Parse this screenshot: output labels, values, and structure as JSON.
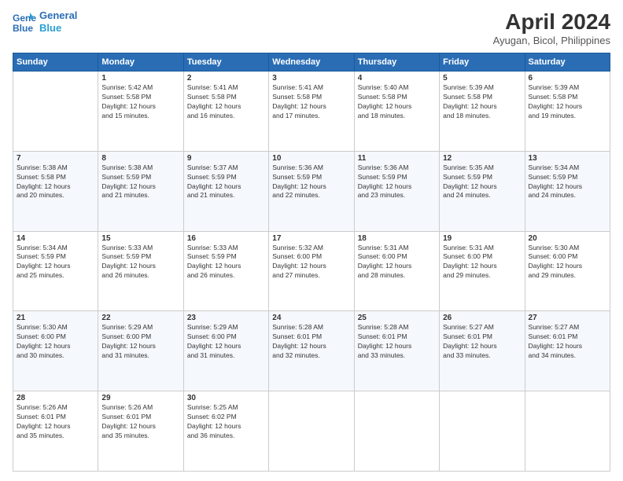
{
  "header": {
    "logo_line1": "General",
    "logo_line2": "Blue",
    "title": "April 2024",
    "location": "Ayugan, Bicol, Philippines"
  },
  "weekdays": [
    "Sunday",
    "Monday",
    "Tuesday",
    "Wednesday",
    "Thursday",
    "Friday",
    "Saturday"
  ],
  "weeks": [
    [
      {
        "day": "",
        "content": ""
      },
      {
        "day": "1",
        "content": "Sunrise: 5:42 AM\nSunset: 5:58 PM\nDaylight: 12 hours\nand 15 minutes."
      },
      {
        "day": "2",
        "content": "Sunrise: 5:41 AM\nSunset: 5:58 PM\nDaylight: 12 hours\nand 16 minutes."
      },
      {
        "day": "3",
        "content": "Sunrise: 5:41 AM\nSunset: 5:58 PM\nDaylight: 12 hours\nand 17 minutes."
      },
      {
        "day": "4",
        "content": "Sunrise: 5:40 AM\nSunset: 5:58 PM\nDaylight: 12 hours\nand 18 minutes."
      },
      {
        "day": "5",
        "content": "Sunrise: 5:39 AM\nSunset: 5:58 PM\nDaylight: 12 hours\nand 18 minutes."
      },
      {
        "day": "6",
        "content": "Sunrise: 5:39 AM\nSunset: 5:58 PM\nDaylight: 12 hours\nand 19 minutes."
      }
    ],
    [
      {
        "day": "7",
        "content": "Sunrise: 5:38 AM\nSunset: 5:58 PM\nDaylight: 12 hours\nand 20 minutes."
      },
      {
        "day": "8",
        "content": "Sunrise: 5:38 AM\nSunset: 5:59 PM\nDaylight: 12 hours\nand 21 minutes."
      },
      {
        "day": "9",
        "content": "Sunrise: 5:37 AM\nSunset: 5:59 PM\nDaylight: 12 hours\nand 21 minutes."
      },
      {
        "day": "10",
        "content": "Sunrise: 5:36 AM\nSunset: 5:59 PM\nDaylight: 12 hours\nand 22 minutes."
      },
      {
        "day": "11",
        "content": "Sunrise: 5:36 AM\nSunset: 5:59 PM\nDaylight: 12 hours\nand 23 minutes."
      },
      {
        "day": "12",
        "content": "Sunrise: 5:35 AM\nSunset: 5:59 PM\nDaylight: 12 hours\nand 24 minutes."
      },
      {
        "day": "13",
        "content": "Sunrise: 5:34 AM\nSunset: 5:59 PM\nDaylight: 12 hours\nand 24 minutes."
      }
    ],
    [
      {
        "day": "14",
        "content": "Sunrise: 5:34 AM\nSunset: 5:59 PM\nDaylight: 12 hours\nand 25 minutes."
      },
      {
        "day": "15",
        "content": "Sunrise: 5:33 AM\nSunset: 5:59 PM\nDaylight: 12 hours\nand 26 minutes."
      },
      {
        "day": "16",
        "content": "Sunrise: 5:33 AM\nSunset: 5:59 PM\nDaylight: 12 hours\nand 26 minutes."
      },
      {
        "day": "17",
        "content": "Sunrise: 5:32 AM\nSunset: 6:00 PM\nDaylight: 12 hours\nand 27 minutes."
      },
      {
        "day": "18",
        "content": "Sunrise: 5:31 AM\nSunset: 6:00 PM\nDaylight: 12 hours\nand 28 minutes."
      },
      {
        "day": "19",
        "content": "Sunrise: 5:31 AM\nSunset: 6:00 PM\nDaylight: 12 hours\nand 29 minutes."
      },
      {
        "day": "20",
        "content": "Sunrise: 5:30 AM\nSunset: 6:00 PM\nDaylight: 12 hours\nand 29 minutes."
      }
    ],
    [
      {
        "day": "21",
        "content": "Sunrise: 5:30 AM\nSunset: 6:00 PM\nDaylight: 12 hours\nand 30 minutes."
      },
      {
        "day": "22",
        "content": "Sunrise: 5:29 AM\nSunset: 6:00 PM\nDaylight: 12 hours\nand 31 minutes."
      },
      {
        "day": "23",
        "content": "Sunrise: 5:29 AM\nSunset: 6:00 PM\nDaylight: 12 hours\nand 31 minutes."
      },
      {
        "day": "24",
        "content": "Sunrise: 5:28 AM\nSunset: 6:01 PM\nDaylight: 12 hours\nand 32 minutes."
      },
      {
        "day": "25",
        "content": "Sunrise: 5:28 AM\nSunset: 6:01 PM\nDaylight: 12 hours\nand 33 minutes."
      },
      {
        "day": "26",
        "content": "Sunrise: 5:27 AM\nSunset: 6:01 PM\nDaylight: 12 hours\nand 33 minutes."
      },
      {
        "day": "27",
        "content": "Sunrise: 5:27 AM\nSunset: 6:01 PM\nDaylight: 12 hours\nand 34 minutes."
      }
    ],
    [
      {
        "day": "28",
        "content": "Sunrise: 5:26 AM\nSunset: 6:01 PM\nDaylight: 12 hours\nand 35 minutes."
      },
      {
        "day": "29",
        "content": "Sunrise: 5:26 AM\nSunset: 6:01 PM\nDaylight: 12 hours\nand 35 minutes."
      },
      {
        "day": "30",
        "content": "Sunrise: 5:25 AM\nSunset: 6:02 PM\nDaylight: 12 hours\nand 36 minutes."
      },
      {
        "day": "",
        "content": ""
      },
      {
        "day": "",
        "content": ""
      },
      {
        "day": "",
        "content": ""
      },
      {
        "day": "",
        "content": ""
      }
    ]
  ]
}
